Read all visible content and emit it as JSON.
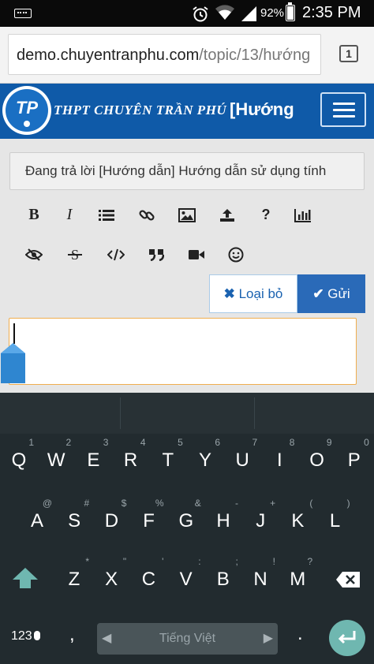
{
  "status_bar": {
    "battery_percent": "92%",
    "battery_level": 0.92,
    "time": "2:35 PM",
    "icons": [
      "keyboard-icon",
      "alarm-icon",
      "wifi-icon",
      "signal-icon",
      "battery-icon"
    ]
  },
  "browser": {
    "url_host": "demo.chuyentranphu.com",
    "url_path": "/topic/13/hướng",
    "tab_count": "1"
  },
  "site": {
    "logo_text": "TP",
    "school_name": "THPT CHUYÊN TRẦN PHÚ",
    "page_title": "[Hướng"
  },
  "composer": {
    "replying_to": "Đang trả lời [Hướng dẫn] Hướng dẫn sử dụng tính",
    "toolbar": [
      "bold",
      "italic",
      "list",
      "link",
      "image",
      "upload",
      "help",
      "chart",
      "hide",
      "strikethrough",
      "code",
      "quote",
      "video",
      "emoji"
    ],
    "bold_label": "B",
    "italic_label": "I",
    "help_label": "?",
    "discard_label": "Loại bỏ",
    "send_label": "Gửi",
    "body": ""
  },
  "keyboard": {
    "row1": [
      {
        "k": "Q",
        "h": "1"
      },
      {
        "k": "W",
        "h": "2"
      },
      {
        "k": "E",
        "h": "3"
      },
      {
        "k": "R",
        "h": "4"
      },
      {
        "k": "T",
        "h": "5"
      },
      {
        "k": "Y",
        "h": "6"
      },
      {
        "k": "U",
        "h": "7"
      },
      {
        "k": "I",
        "h": "8"
      },
      {
        "k": "O",
        "h": "9"
      },
      {
        "k": "P",
        "h": "0"
      }
    ],
    "row2": [
      {
        "k": "A",
        "h": "@"
      },
      {
        "k": "S",
        "h": "#"
      },
      {
        "k": "D",
        "h": "$"
      },
      {
        "k": "F",
        "h": "%"
      },
      {
        "k": "G",
        "h": "&"
      },
      {
        "k": "H",
        "h": "-"
      },
      {
        "k": "J",
        "h": "+"
      },
      {
        "k": "K",
        "h": "("
      },
      {
        "k": "L",
        "h": ")"
      }
    ],
    "row3": [
      {
        "k": "Z",
        "h": "*"
      },
      {
        "k": "X",
        "h": "\""
      },
      {
        "k": "C",
        "h": "'"
      },
      {
        "k": "V",
        "h": ":"
      },
      {
        "k": "B",
        "h": ";"
      },
      {
        "k": "N",
        "h": "!"
      },
      {
        "k": "M",
        "h": "?"
      }
    ],
    "num_label": "123",
    "comma": ",",
    "period": ".",
    "space_label": "Tiếng Việt",
    "enter_color": "#6fb7b0",
    "shift_color": "#6fb7b0"
  },
  "colors": {
    "header_bg": "#0f5aa8",
    "send_bg": "#2a6ab8",
    "editor_border": "#f0ad4e",
    "keyboard_bg": "#222b2f"
  }
}
